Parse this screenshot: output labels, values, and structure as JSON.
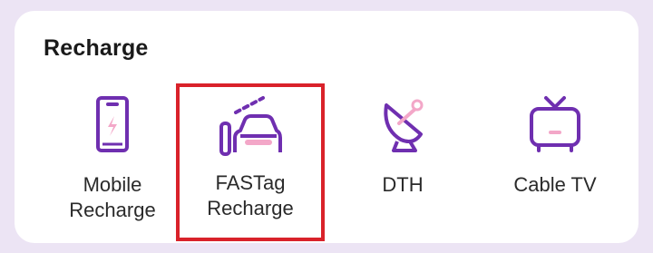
{
  "section": {
    "title": "Recharge"
  },
  "tiles": [
    {
      "label_line1": "Mobile",
      "label_line2": "Recharge",
      "icon": "mobile-phone-charge-icon"
    },
    {
      "label_line1": "FASTag",
      "label_line2": "Recharge",
      "icon": "fastag-car-icon"
    },
    {
      "label_line1": "DTH",
      "label_line2": "",
      "icon": "satellite-dish-icon"
    },
    {
      "label_line1": "Cable TV",
      "label_line2": "",
      "icon": "tv-icon"
    }
  ],
  "colors": {
    "accent": "#6f2fb0",
    "highlight_border": "#d9222a",
    "page_bg": "#ece4f4"
  }
}
